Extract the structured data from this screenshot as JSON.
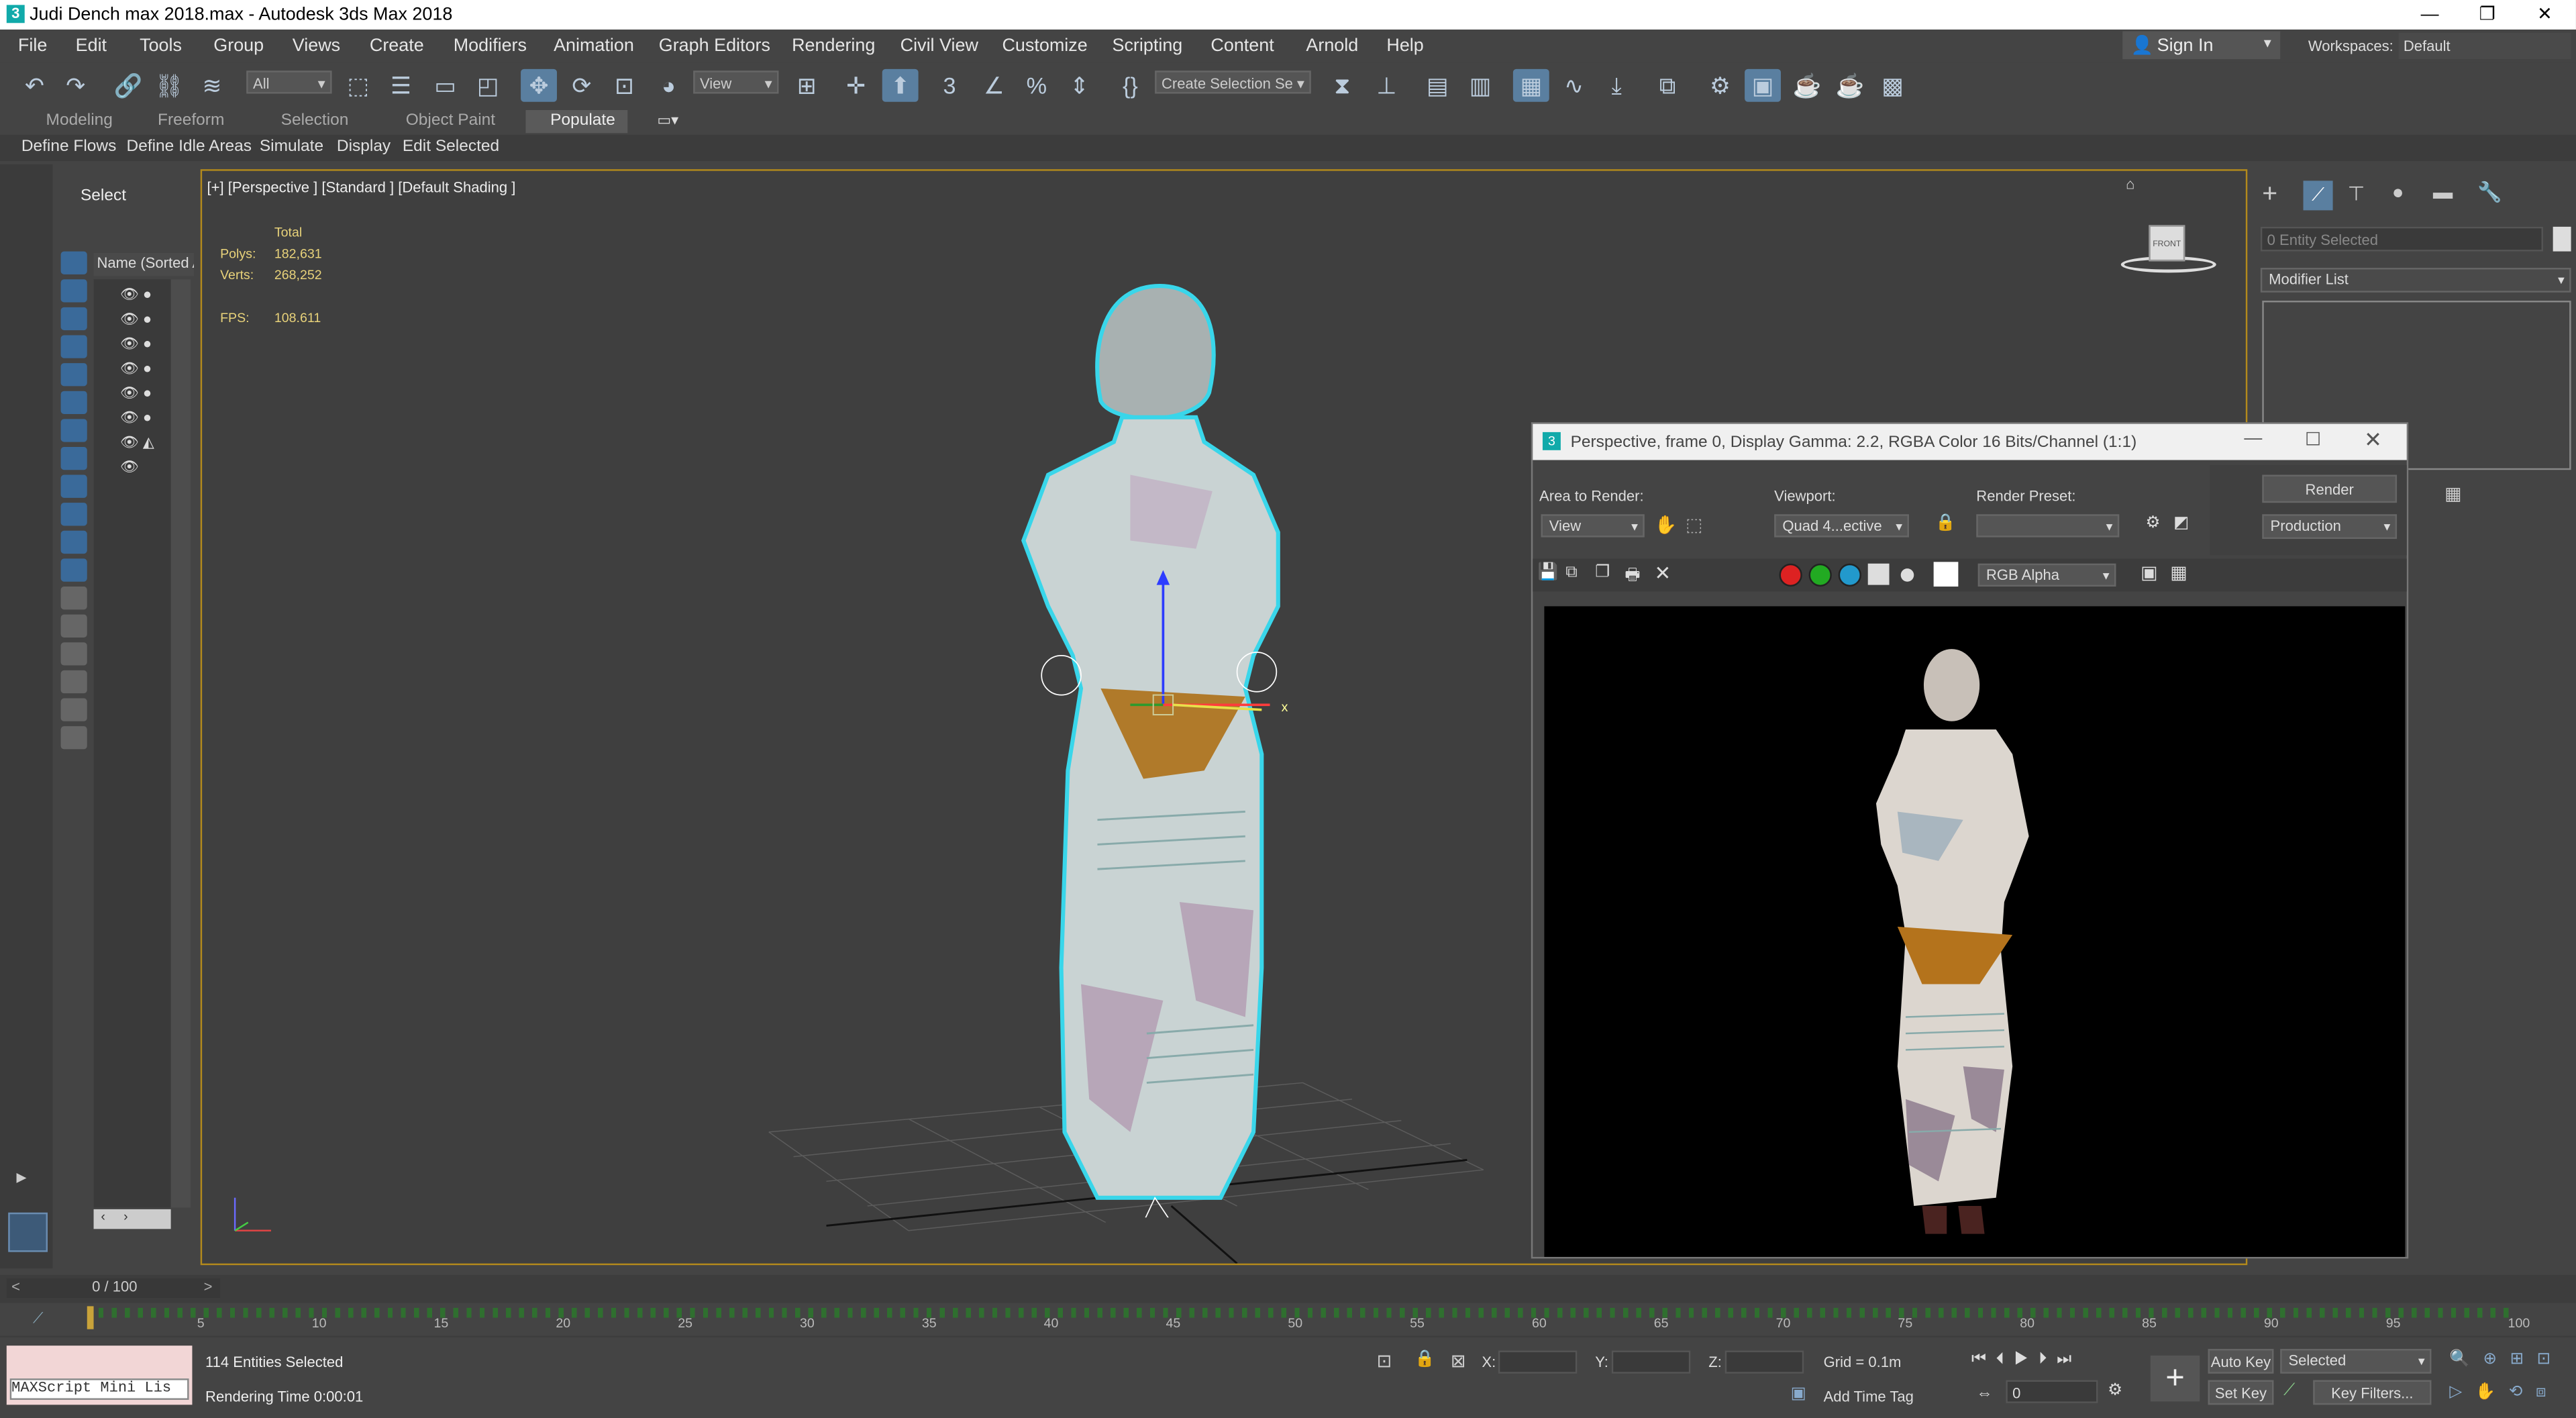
{
  "window": {
    "title": "Judi Dench max 2018.max - Autodesk 3ds Max 2018"
  },
  "menu": [
    "File",
    "Edit",
    "Tools",
    "Group",
    "Views",
    "Create",
    "Modifiers",
    "Animation",
    "Graph Editors",
    "Rendering",
    "Civil View",
    "Customize",
    "Scripting",
    "Content",
    "Arnold",
    "Help"
  ],
  "account": {
    "sign_in": "Sign In",
    "workspaces_label": "Workspaces:",
    "workspace_value": "Default"
  },
  "toolbar": {
    "filter_value": "All",
    "ref_coord_value": "View",
    "selection_set_value": "Create Selection Se"
  },
  "ribbon": {
    "tabs": [
      "Modeling",
      "Freeform",
      "Selection",
      "Object Paint",
      "Populate"
    ],
    "buttons": [
      "Define Flows",
      "Define Idle Areas",
      "Simulate",
      "Display",
      "Edit Selected"
    ]
  },
  "scene_explorer": {
    "select_label": "Select",
    "column_header": "Name (Sorted A"
  },
  "viewport": {
    "label": "[+] [Perspective ] [Standard ] [Default Shading ]",
    "stats": {
      "total_label": "Total",
      "polys_label": "Polys:",
      "polys_value": "182,631",
      "verts_label": "Verts:",
      "verts_value": "268,252",
      "fps_label": "FPS:",
      "fps_value": "108.611"
    },
    "viewcube_label": "FRONT",
    "gizmo_x": "x"
  },
  "command_panel": {
    "entity_field": "0 Entity Selected",
    "modifier_list": "Modifier List"
  },
  "render_window": {
    "title": "Perspective, frame 0, Display Gamma: 2.2, RGBA Color 16 Bits/Channel (1:1)",
    "area_label": "Area to Render:",
    "area_value": "View",
    "viewport_label": "Viewport:",
    "viewport_value": "Quad 4...ective",
    "preset_label": "Render Preset:",
    "preset_value": "",
    "render_button": "Render",
    "production_value": "Production",
    "channel_value": "RGB Alpha"
  },
  "timeline": {
    "frame_display": "0 / 100",
    "ticks": [
      "5",
      "10",
      "15",
      "20",
      "25",
      "30",
      "35",
      "40",
      "45",
      "50",
      "55",
      "60",
      "65",
      "70",
      "75",
      "80",
      "85",
      "90",
      "95",
      "100"
    ]
  },
  "status": {
    "maxscript": "MAXScript Mini Lis",
    "entities": "114 Entities Selected",
    "rendering_time": "Rendering Time  0:00:01",
    "x_label": "X:",
    "y_label": "Y:",
    "z_label": "Z:",
    "grid": "Grid = 0.1m",
    "add_time_tag": "Add Time Tag",
    "auto_key": "Auto Key",
    "selected_value": "Selected",
    "set_key": "Set Key",
    "key_filters": "Key Filters...",
    "frame_value": "0"
  },
  "colors": {
    "accent_blue": "#5a7fa0",
    "viewport_border": "#b38a1c",
    "stats_text": "#e8d27a",
    "selection_outline": "#39d6ea"
  }
}
